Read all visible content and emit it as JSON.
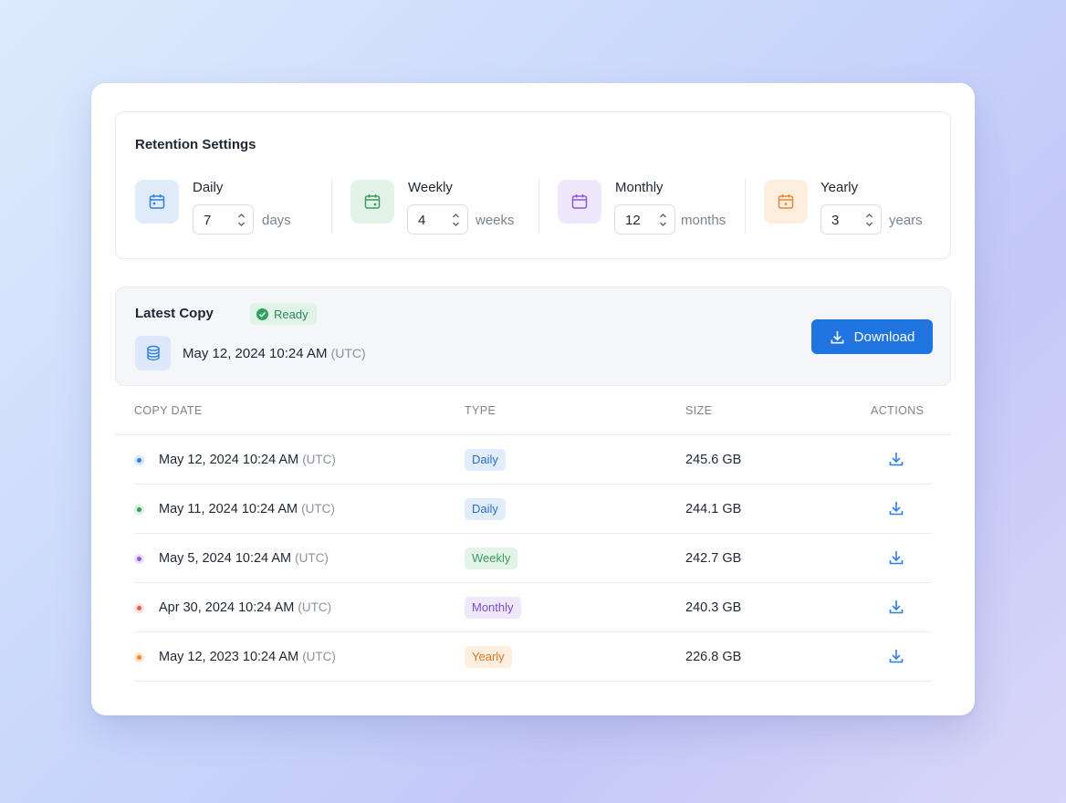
{
  "retention": {
    "title": "Retention Settings",
    "items": [
      {
        "label": "Daily",
        "value": "7",
        "unit": "days",
        "icon": "calendar-icon",
        "color": "#2f7fe0",
        "bg": "#e1ecfb"
      },
      {
        "label": "Weekly",
        "value": "4",
        "unit": "weeks",
        "icon": "calendar-icon",
        "color": "#3d9a63",
        "bg": "#e3f3e8"
      },
      {
        "label": "Monthly",
        "value": "12",
        "unit": "months",
        "icon": "calendar-icon",
        "color": "#8b5bd6",
        "bg": "#efe7fb"
      },
      {
        "label": "Yearly",
        "value": "3",
        "unit": "years",
        "icon": "calendar-icon",
        "color": "#e3883a",
        "bg": "#fdeede"
      }
    ]
  },
  "latest": {
    "title": "Latest Copy",
    "status": "Ready",
    "date": "May 12, 2024 10:24 AM",
    "timezone": "(UTC)",
    "download_label": "Download"
  },
  "table": {
    "headers": {
      "date": "COPY DATE",
      "type": "TYPE",
      "size": "SIZE",
      "actions": "ACTIONS"
    },
    "rows": [
      {
        "date": "May 12, 2024 10:24 AM",
        "tz": "(UTC)",
        "type": "Daily",
        "size": "245.6 GB",
        "dot": "#2f7fe0",
        "badge_bg": "#e2edfb",
        "badge_fg": "#2a6fcb"
      },
      {
        "date": "May 11, 2024 10:24 AM",
        "tz": "(UTC)",
        "type": "Daily",
        "size": "244.1 GB",
        "dot": "#3a9a5e",
        "badge_bg": "#e2edfb",
        "badge_fg": "#2a6fcb"
      },
      {
        "date": "May 5, 2024 10:24 AM",
        "tz": "(UTC)",
        "type": "Weekly",
        "size": "242.7 GB",
        "dot": "#8b5bd6",
        "badge_bg": "#e3f3e8",
        "badge_fg": "#3d9a63"
      },
      {
        "date": "Apr 30, 2024 10:24 AM",
        "tz": "(UTC)",
        "type": "Monthly",
        "size": "240.3 GB",
        "dot": "#d9604a",
        "badge_bg": "#efe7fb",
        "badge_fg": "#7d50c8"
      },
      {
        "date": "May 12, 2023 10:24 AM",
        "tz": "(UTC)",
        "type": "Yearly",
        "size": "226.8 GB",
        "dot": "#ef8a2c",
        "badge_bg": "#fdeede",
        "badge_fg": "#d9782a"
      }
    ]
  },
  "colors": {
    "accent": "#1f74e0",
    "ready_bg": "#dff3e6",
    "ready_fg": "#2f8a56"
  }
}
